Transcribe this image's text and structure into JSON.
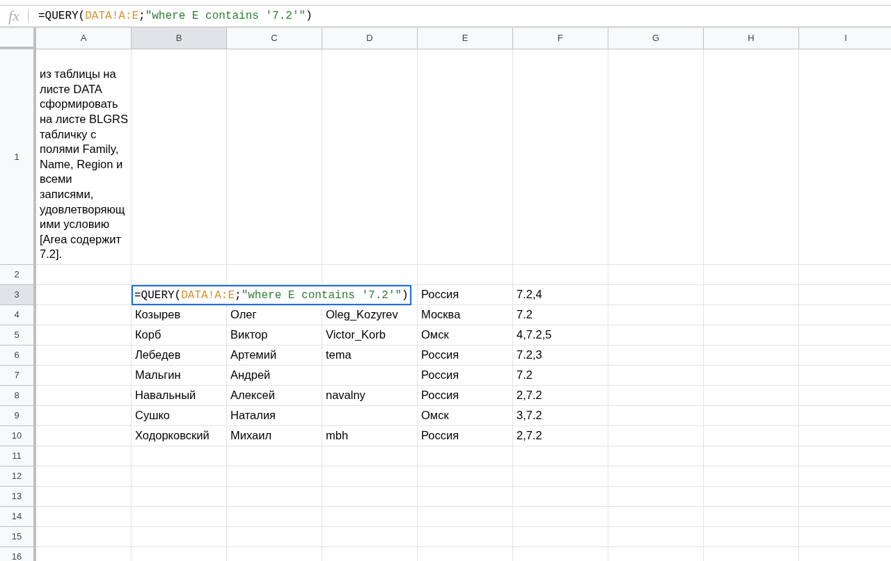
{
  "formula_bar": {
    "fx_label": "fx",
    "segments": [
      {
        "kind": "plain",
        "text": "=QUERY("
      },
      {
        "kind": "range",
        "text": "DATA!A:E"
      },
      {
        "kind": "plain",
        "text": ";"
      },
      {
        "kind": "string",
        "text": "\"where E contains '7.2'\""
      },
      {
        "kind": "plain",
        "text": ")"
      }
    ]
  },
  "columns": [
    {
      "label": "A",
      "selected": false
    },
    {
      "label": "B",
      "selected": true
    },
    {
      "label": "C",
      "selected": false
    },
    {
      "label": "D",
      "selected": false
    },
    {
      "label": "E",
      "selected": false
    },
    {
      "label": "F",
      "selected": false
    },
    {
      "label": "G",
      "selected": false
    },
    {
      "label": "H",
      "selected": false
    },
    {
      "label": "I",
      "selected": false
    }
  ],
  "rows": [
    {
      "label": "1",
      "selected": false,
      "cells": {
        "A": "из таблицы на листе DATA сформировать на листе BLGRS табличку с полями Family, Name, Region и всеми записями, удовлетворяющими условию [Area содержит 7.2]."
      }
    },
    {
      "label": "2",
      "selected": false
    },
    {
      "label": "3",
      "selected": true,
      "cells": {
        "E": "Россия",
        "F": "7.2,4"
      }
    },
    {
      "label": "4",
      "selected": false,
      "cells": {
        "B": "Козырев",
        "C": "Олег",
        "D": "Oleg_Kozyrev",
        "E": "Москва",
        "F": "7.2"
      }
    },
    {
      "label": "5",
      "selected": false,
      "cells": {
        "B": "Корб",
        "C": "Виктор",
        "D": "Victor_Korb",
        "E": "Омск",
        "F": "4,7.2,5"
      }
    },
    {
      "label": "6",
      "selected": false,
      "cells": {
        "B": "Лебедев",
        "C": "Артемий",
        "D": "tema",
        "E": "Россия",
        "F": "7.2,3"
      }
    },
    {
      "label": "7",
      "selected": false,
      "cells": {
        "B": "Мальгин",
        "C": "Андрей",
        "E": "Россия",
        "F": "7.2"
      }
    },
    {
      "label": "8",
      "selected": false,
      "cells": {
        "B": "Навальный",
        "C": "Алексей",
        "D": "navalny",
        "E": "Россия",
        "F": "2,7.2"
      }
    },
    {
      "label": "9",
      "selected": false,
      "cells": {
        "B": "Сушко",
        "C": "Наталия",
        "E": "Омск",
        "F": "3,7.2"
      }
    },
    {
      "label": "10",
      "selected": false,
      "cells": {
        "B": "Ходорковский",
        "C": "Михаил",
        "D": "mbh",
        "E": "Россия",
        "F": "2,7.2"
      }
    },
    {
      "label": "11",
      "selected": false
    },
    {
      "label": "12",
      "selected": false
    },
    {
      "label": "13",
      "selected": false
    },
    {
      "label": "14",
      "selected": false
    },
    {
      "label": "15",
      "selected": false
    },
    {
      "label": "16",
      "selected": false
    }
  ],
  "cell_editor": {
    "segments": [
      {
        "kind": "plain",
        "text": "=QUERY("
      },
      {
        "kind": "range",
        "text": "DATA!A:E"
      },
      {
        "kind": "plain",
        "text": ";"
      },
      {
        "kind": "string",
        "text": "\"where E contains '7.2'\""
      },
      {
        "kind": "plain",
        "text": ")"
      }
    ]
  }
}
